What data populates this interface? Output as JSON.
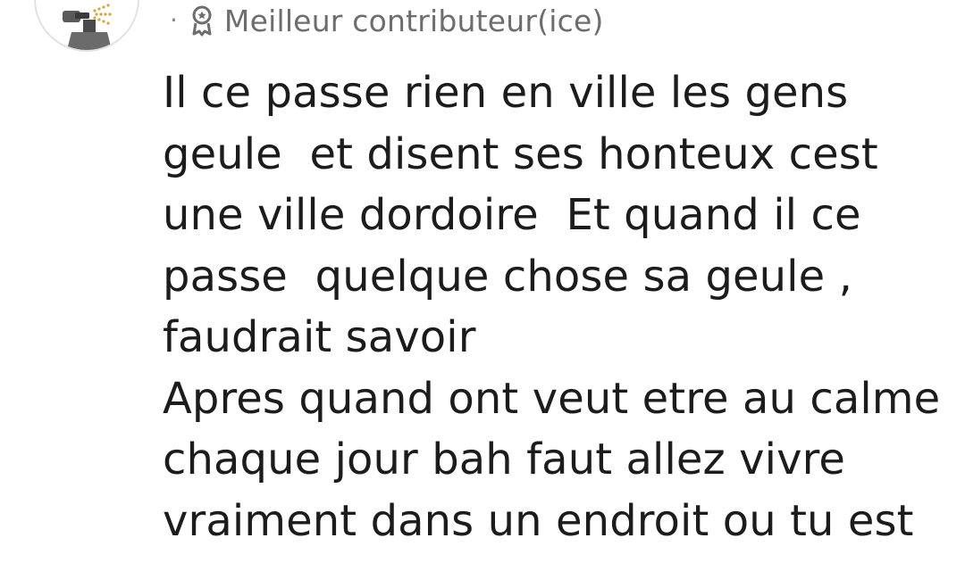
{
  "comment": {
    "separator": "·",
    "badge": {
      "icon": "award-ribbon-icon",
      "label": "Meilleur contributeur(ice)"
    },
    "avatar": {
      "icon": "perfume-spray-icon"
    },
    "text_lines": [
      "Il ce passe rien en ville les gens",
      "geule  et disent ses honteux cest",
      "une ville dordoire  Et quand il ce",
      "passe  quelque chose sa geule ,",
      "faudrait savoir",
      "Apres quand ont veut etre au calme",
      "chaque jour bah faut allez vivre",
      "vraiment dans un endroit ou tu est"
    ]
  },
  "colors": {
    "text": "#1c1c1c",
    "meta": "#6d6d6d",
    "avatar_border": "#e2e2e2",
    "background": "#ffffff"
  }
}
